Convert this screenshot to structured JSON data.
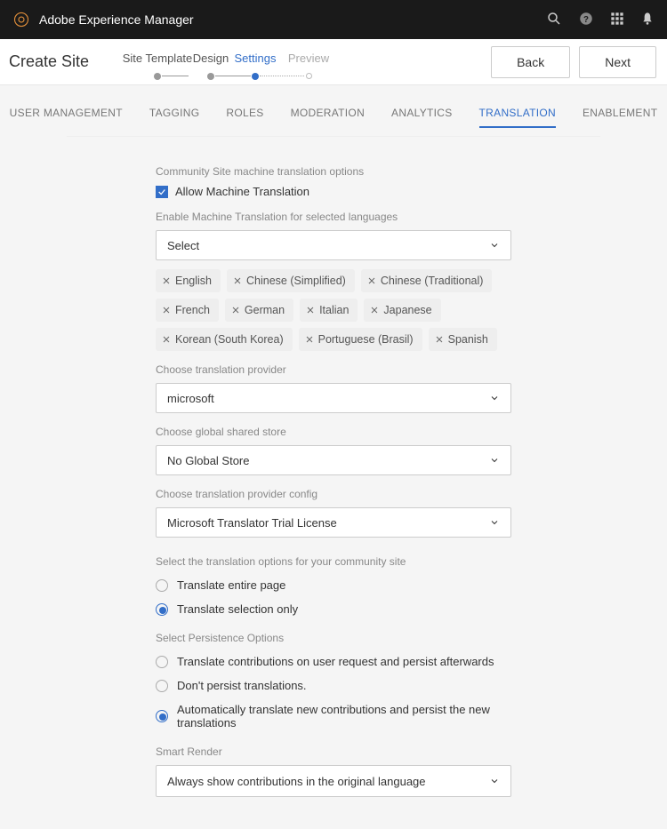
{
  "header": {
    "appTitle": "Adobe Experience Manager"
  },
  "wizard": {
    "title": "Create Site",
    "steps": [
      "Site Template",
      "Design",
      "Settings",
      "Preview"
    ],
    "back": "Back",
    "next": "Next"
  },
  "tabs": [
    "USER MANAGEMENT",
    "TAGGING",
    "ROLES",
    "MODERATION",
    "ANALYTICS",
    "TRANSLATION",
    "ENABLEMENT"
  ],
  "form": {
    "optionsLabel": "Community Site machine translation options",
    "allowMT": "Allow Machine Translation",
    "enableLabel": "Enable Machine Translation for selected languages",
    "selectPlaceholder": "Select",
    "languages": [
      "English",
      "Chinese (Simplified)",
      "Chinese (Traditional)",
      "French",
      "German",
      "Italian",
      "Japanese",
      "Korean (South Korea)",
      "Portuguese (Brasil)",
      "Spanish"
    ],
    "providerLabel": "Choose translation provider",
    "providerValue": "microsoft",
    "storeLabel": "Choose global shared store",
    "storeValue": "No Global Store",
    "configLabel": "Choose translation provider config",
    "configValue": "Microsoft Translator Trial License",
    "translateOptionsLabel": "Select the translation options for your community site",
    "translateEntire": "Translate entire page",
    "translateSelection": "Translate selection only",
    "persistenceLabel": "Select Persistence Options",
    "persistOpt1": "Translate contributions on user request and persist afterwards",
    "persistOpt2": "Don't persist translations.",
    "persistOpt3": "Automatically translate new contributions and persist the new translations",
    "smartRenderLabel": "Smart Render",
    "smartRenderValue": "Always show contributions in the original language"
  }
}
